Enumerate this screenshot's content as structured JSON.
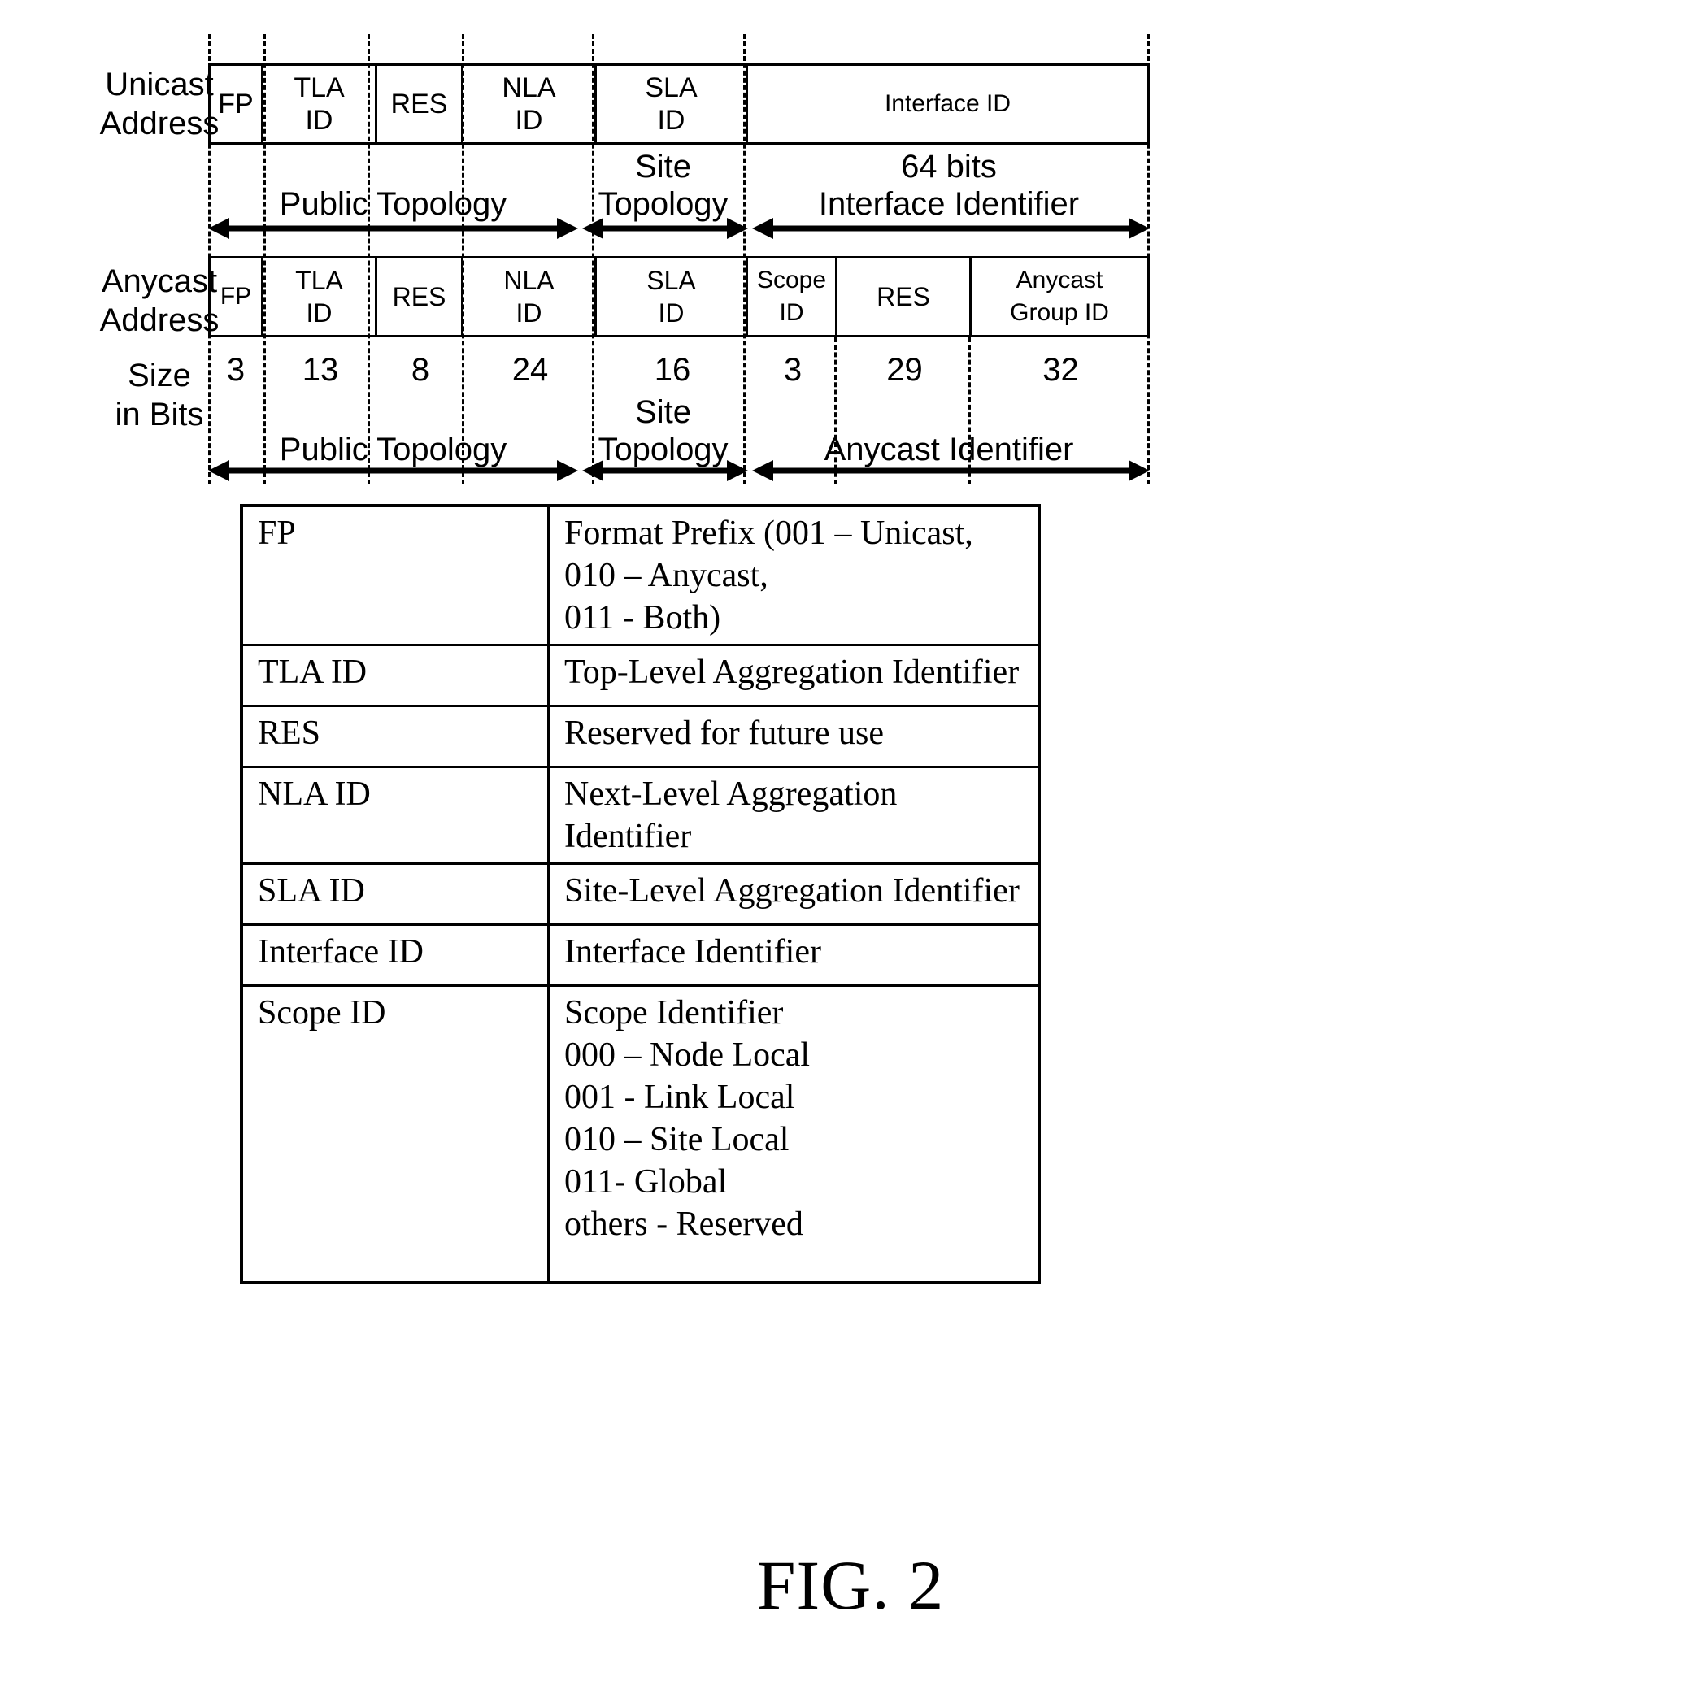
{
  "figure": {
    "caption": "FIG. 2"
  },
  "unicast": {
    "row_label": "Unicast\nAddress",
    "fields": [
      {
        "label": "FP"
      },
      {
        "label": "TLA\nID"
      },
      {
        "label": "RES"
      },
      {
        "label": "NLA\nID"
      },
      {
        "label": "SLA\nID"
      },
      {
        "label": "Interface ID"
      }
    ],
    "bands": [
      {
        "label": "Public Topology"
      },
      {
        "label": "Site\nTopology"
      },
      {
        "label": "64 bits\nInterface Identifier"
      }
    ]
  },
  "anycast": {
    "row_label": "Anycast\nAddress",
    "fields": [
      {
        "label": "FP"
      },
      {
        "label": "TLA\nID"
      },
      {
        "label": "RES"
      },
      {
        "label": "NLA\nID"
      },
      {
        "label": "SLA\nID"
      },
      {
        "label": "Scope\nID"
      },
      {
        "label": "RES"
      },
      {
        "label": "Anycast\nGroup ID"
      }
    ],
    "bands": [
      {
        "label": "Public Topology"
      },
      {
        "label": "Site\nTopology"
      },
      {
        "label": "Anycast Identifier"
      }
    ]
  },
  "size_row": {
    "row_label": "Size\nin Bits",
    "values": [
      "3",
      "13",
      "8",
      "24",
      "16",
      "3",
      "29",
      "32"
    ]
  },
  "legend": {
    "rows": [
      {
        "term": "FP",
        "description": "Format Prefix (001 – Unicast, 010 – Anycast,\n011 - Both)"
      },
      {
        "term": "TLA ID",
        "description": "Top-Level Aggregation Identifier"
      },
      {
        "term": "RES",
        "description": "Reserved for future use"
      },
      {
        "term": "NLA ID",
        "description": "Next-Level Aggregation Identifier"
      },
      {
        "term": "SLA ID",
        "description": "Site-Level Aggregation Identifier"
      },
      {
        "term": "Interface ID",
        "description": "Interface Identifier"
      },
      {
        "term": "Scope ID",
        "description": "Scope Identifier\n000 – Node Local\n001 - Link Local\n010 – Site Local\n011- Global\nothers - Reserved"
      }
    ]
  }
}
